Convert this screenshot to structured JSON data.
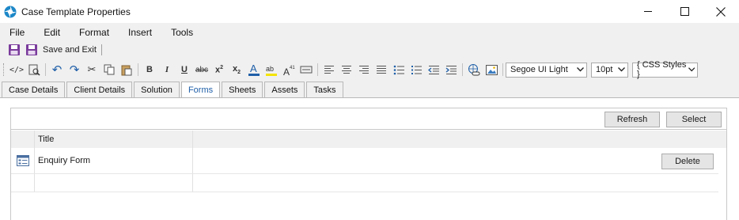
{
  "window": {
    "title": "Case Template Properties",
    "controls": [
      "minimize-icon",
      "maximize-icon",
      "close-icon"
    ]
  },
  "menu": [
    "File",
    "Edit",
    "Format",
    "Insert",
    "Tools"
  ],
  "saverow": {
    "save_exit_label": "Save and Exit"
  },
  "toolbar": {
    "font_name": "Segoe UI Light",
    "font_size": "10pt",
    "css_styles": "{ CSS Styles }"
  },
  "tabs": [
    {
      "label": "Case Details",
      "active": false
    },
    {
      "label": "Client Details",
      "active": false
    },
    {
      "label": "Solution",
      "active": false
    },
    {
      "label": "Forms",
      "active": true
    },
    {
      "label": "Sheets",
      "active": false
    },
    {
      "label": "Assets",
      "active": false
    },
    {
      "label": "Tasks",
      "active": false
    }
  ],
  "forms": {
    "refresh_label": "Refresh",
    "select_label": "Select",
    "column_title": "Title",
    "rows": [
      {
        "title": "Enquiry Form",
        "delete_label": "Delete"
      }
    ]
  },
  "colors": {
    "accent": "#1f5fa8",
    "save_icon": "#7a3b9c"
  }
}
